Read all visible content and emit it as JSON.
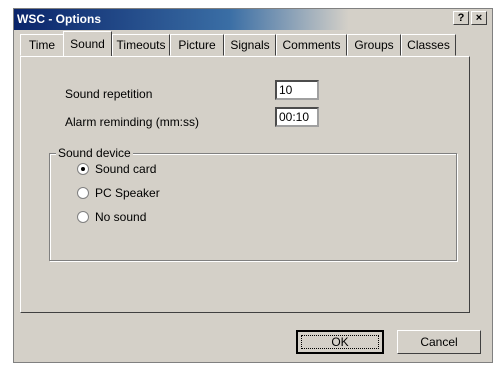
{
  "window": {
    "title": "WSC - Options",
    "help_label": "?",
    "close_label": "×"
  },
  "tabs": [
    "Time",
    "Sound",
    "Timeouts",
    "Picture",
    "Signals",
    "Comments",
    "Groups",
    "Classes"
  ],
  "active_tab": "Sound",
  "sound": {
    "repetition_label": "Sound repetition",
    "repetition_value": "10",
    "alarm_label": "Alarm reminding (mm:ss)",
    "alarm_value": "00:10"
  },
  "device": {
    "title": "Sound device",
    "options": [
      "Sound card",
      "PC Speaker",
      "No sound"
    ],
    "selected": "Sound card"
  },
  "buttons": {
    "ok_label": "OK",
    "cancel_label": "Cancel"
  }
}
